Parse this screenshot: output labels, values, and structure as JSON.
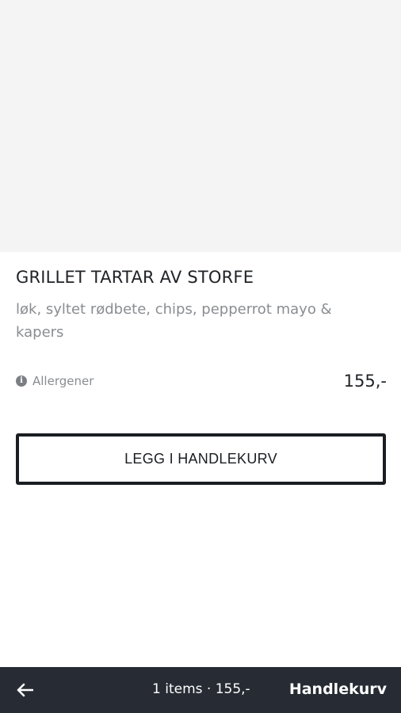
{
  "product": {
    "image_placeholder": "",
    "title": "GRILLET TARTAR AV STORFE",
    "description": "løk, syltet rødbete, chips, pepperrot mayo & kapers",
    "allergen_label": "Allergener",
    "price": "155,-",
    "add_to_cart_label": "LEGG I HANDLEKURV"
  },
  "bottom_bar": {
    "back_icon": "arrow-left-icon",
    "summary": "1 items · 155,-",
    "cart_label": "Handlekurv"
  },
  "colors": {
    "background": "#ffffff",
    "image_placeholder": "#f4f4f4",
    "text_primary": "#1f2226",
    "text_secondary": "#8a8d91",
    "bottom_bar": "#272c34"
  }
}
